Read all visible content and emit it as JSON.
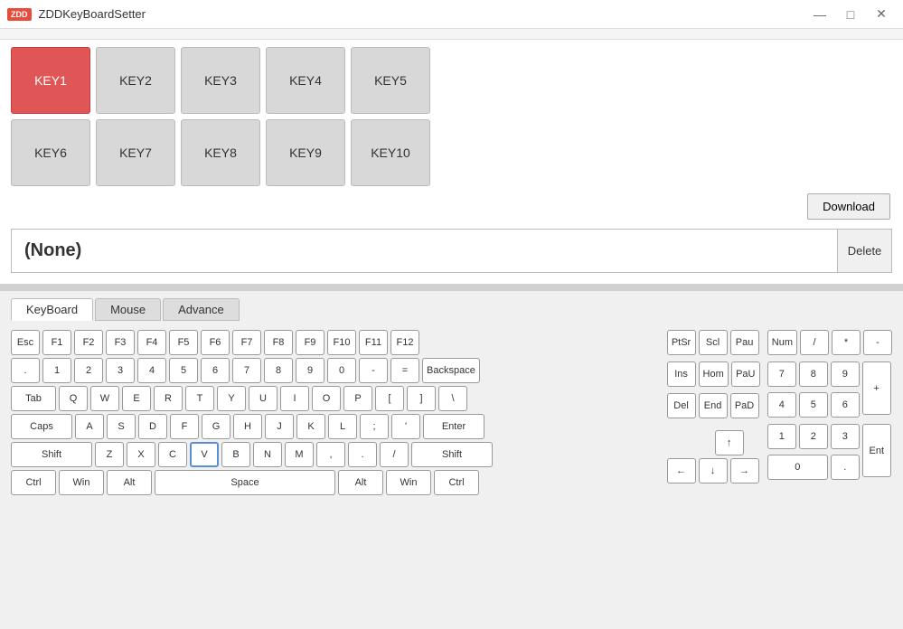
{
  "titlebar": {
    "logo": "ZDD",
    "title": "ZDDKeyBoardSetter",
    "minimize": "—",
    "maximize": "□",
    "close": "✕"
  },
  "keys": {
    "row1": [
      "KEY1",
      "KEY2",
      "KEY3",
      "KEY4",
      "KEY5"
    ],
    "row2": [
      "KEY6",
      "KEY7",
      "KEY8",
      "KEY9",
      "KEY10"
    ],
    "activeKey": "KEY1",
    "download_label": "Download",
    "none_label": "(None)",
    "delete_label": "Delete"
  },
  "tabs": [
    "KeyBoard",
    "Mouse",
    "Advance"
  ],
  "activeTab": "KeyBoard",
  "keyboard": {
    "row_fn": [
      "Esc",
      "F1",
      "F2",
      "F3",
      "F4",
      "F5",
      "F6",
      "F7",
      "F8",
      "F9",
      "F10",
      "F11",
      "F12"
    ],
    "row_num": [
      ".",
      "1",
      "2",
      "3",
      "4",
      "5",
      "6",
      "7",
      "8",
      "9",
      "0",
      "-",
      "=",
      "Backspace"
    ],
    "row_tab": [
      "Tab",
      "Q",
      "W",
      "E",
      "R",
      "T",
      "Y",
      "U",
      "I",
      "O",
      "P",
      "[",
      "]",
      "\\"
    ],
    "row_caps": [
      "Caps",
      "A",
      "S",
      "D",
      "F",
      "G",
      "H",
      "J",
      "K",
      "L",
      ";",
      "'",
      "Enter"
    ],
    "row_shift": [
      "Shift",
      "Z",
      "X",
      "C",
      "V",
      "B",
      "N",
      "M",
      ",",
      ".",
      "/",
      "Shift"
    ],
    "row_bottom": [
      "Ctrl",
      "Win",
      "Alt",
      "Space",
      "Alt",
      "Win",
      "Ctrl"
    ],
    "nav_top": [
      "PtSr",
      "Scl",
      "Pau"
    ],
    "nav_mid": [
      "Ins",
      "Hom",
      "PaU"
    ],
    "nav_bot": [
      "Del",
      "End",
      "PaD"
    ],
    "arrows": [
      "↑",
      "←",
      "↓",
      "→"
    ],
    "numpad_top": [
      "Num",
      "/",
      "*",
      "-"
    ],
    "numpad_mid1": [
      "7",
      "8",
      "9"
    ],
    "numpad_mid2": [
      "4",
      "5",
      "6"
    ],
    "numpad_bot1": [
      "1",
      "2",
      "3"
    ],
    "numpad_bot2": [
      "0",
      "."
    ],
    "num_plus": "+",
    "num_enter": "Ent",
    "active_key": "V"
  }
}
